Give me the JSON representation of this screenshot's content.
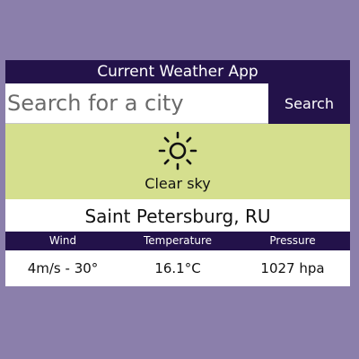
{
  "app": {
    "title": "Current Weather App"
  },
  "search": {
    "placeholder": "Search for a city",
    "value": "",
    "button_label": "Search"
  },
  "conditions": {
    "icon": "sun-icon",
    "description": "Clear sky"
  },
  "location": {
    "city": "Saint Petersburg, RU"
  },
  "stats": {
    "headers": [
      "Wind",
      "Temperature",
      "Pressure"
    ],
    "values": [
      "4m/s - 30°",
      "16.1°C",
      "1027 hpa"
    ]
  },
  "colors": {
    "page_background": "#8b7fab",
    "header_background": "#23124a",
    "conditions_background": "#d5df8e"
  }
}
